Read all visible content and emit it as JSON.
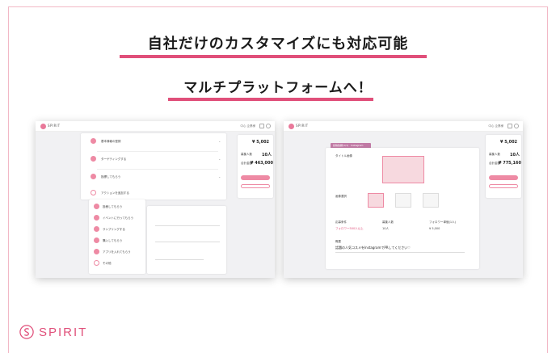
{
  "headline_1": "自社だけのカスタマイズにも対応可能",
  "headline_2": "マルチプラットフォームへ！",
  "brand": {
    "name": "SPIRIT",
    "color": "#e04f7a"
  },
  "screen_left": {
    "app_name": "SPIRIT",
    "header_link": "中心 企業様",
    "steps": [
      "基本情報の登録",
      "ターゲティングする",
      "指標してもらう"
    ],
    "action_add": "アクションを追加する",
    "menu_items": [
      "投稿してもらう",
      "イベントに行ってもらう",
      "サンプリングする",
      "購入してもらう",
      "アプリを入れてもらう",
      "その他"
    ],
    "side": {
      "price_1": "¥ 5,002",
      "people_label": "募集人数",
      "people_value": "10人",
      "total_label": "合計金額",
      "total_value": "¥ 463,000",
      "primary_button": "プレビュー確認",
      "secondary_button": "下書き保存"
    }
  },
  "screen_right": {
    "app_name": "SPIRIT",
    "header_link": "中心 企業様",
    "tab_label": "投稿依頼(1/1)　Instagram",
    "field_title_label": "タイトル画像",
    "field_image_label": "画像選択",
    "col_labels": [
      "応募条件",
      "募集人数",
      "フォロワー単価(1人)"
    ],
    "col_values": [
      "フォロワー500人以上",
      "10人",
      "¥ 5,000"
    ],
    "description_label": "概要",
    "description_value": "話題の人気コスメをInstagramでPRしてください♡",
    "side": {
      "price_1": "¥ 5,002",
      "people_label": "募集人数",
      "people_value": "10人",
      "total_label": "合計金額",
      "total_value": "¥ 775,160",
      "primary_button": "プレビュー確認",
      "secondary_button": "下書き保存"
    }
  },
  "colors": {
    "accent": "#e04f7a",
    "soft_pink": "#ee8aa4"
  }
}
